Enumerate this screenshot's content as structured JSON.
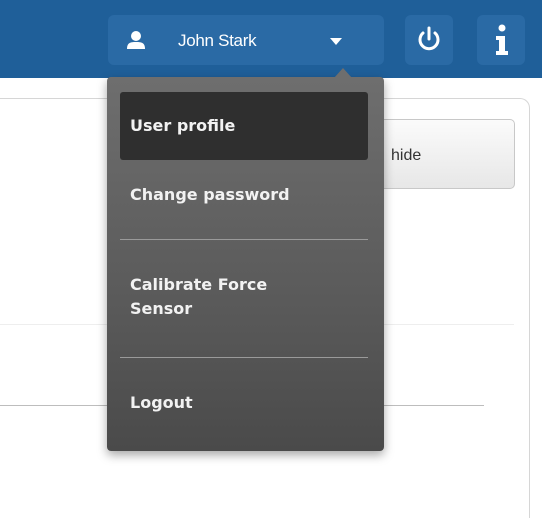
{
  "header": {
    "user_name": "John Stark",
    "user_icon": "user-icon",
    "caret_icon": "caret-down-icon",
    "power_icon": "power-icon",
    "info_icon": "info-icon",
    "accent_color": "#1f5f99"
  },
  "panel": {
    "hide_label": "hide"
  },
  "user_menu": {
    "items": [
      {
        "label": "User profile",
        "active": true
      },
      {
        "label": "Change password",
        "active": false
      },
      {
        "label": "Calibrate Force Sensor",
        "active": false
      },
      {
        "label": "Logout",
        "active": false
      }
    ]
  }
}
